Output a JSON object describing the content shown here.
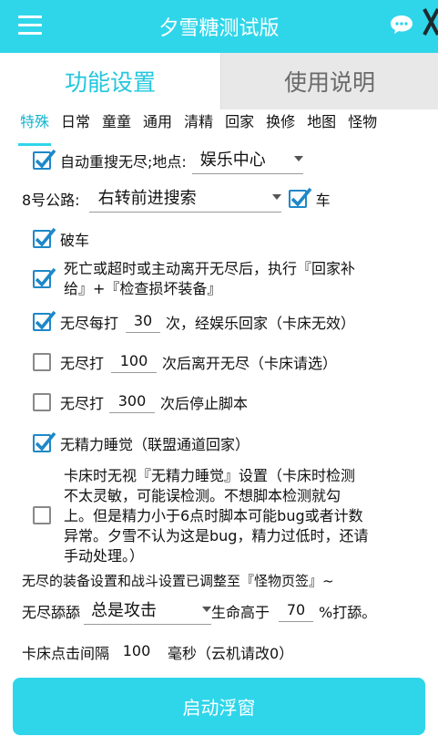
{
  "app": {
    "title": "夕雪糖测试版"
  },
  "tabs": {
    "active": "功能设置",
    "inactive": "使用说明"
  },
  "categories": [
    "特殊",
    "日常",
    "童童",
    "通用",
    "清精",
    "回家",
    "换修",
    "地图",
    "怪物"
  ],
  "settings": {
    "auto_search": {
      "checked": true,
      "label": "自动重搜无尽;地点:",
      "location": "娱乐中心"
    },
    "road8": {
      "label": "8号公路:",
      "value": "右转前进搜索",
      "car_checked": true,
      "car_label": "车"
    },
    "broken_car": {
      "checked": true,
      "label": "破车"
    },
    "death_repair": {
      "checked": true,
      "line1": "死亡或超时或主动离开无尽后，执行『回家补",
      "line2": "给』+『检查损坏装备』"
    },
    "every_hit": {
      "checked": true,
      "prefix": "无尽每打",
      "value": "30",
      "suffix": "次，经娱乐回家（卡床无效）"
    },
    "leave_after": {
      "checked": false,
      "prefix": "无尽打",
      "value": "100",
      "suffix": "次后离开无尽（卡床请选）"
    },
    "stop_after": {
      "checked": false,
      "prefix": "无尽打",
      "value": "300",
      "suffix": "次后停止脚本"
    },
    "no_energy_sleep": {
      "checked": true,
      "label": "无精力睡觉（联盟通道回家）"
    },
    "bed_ignore": {
      "checked": false,
      "lines": [
        "卡床时无视『无精力睡觉』设置（卡床时检测",
        "不太灵敏，可能误检测。不想脚本检测就勾",
        "上。但是精力小于6点时脚本可能bug或者计数",
        "异常。夕雪不认为这是bug，精力过低时，还请",
        "手动处理。）"
      ]
    },
    "notice": "无尽的装备设置和战斗设置已调整至『怪物页签』~",
    "lick": {
      "prefix": "无尽舔舔",
      "mode": "总是攻击",
      "mid": "生命高于",
      "value": "70",
      "suffix": "%打舔。"
    },
    "interval": {
      "prefix": "卡床点击间隔",
      "value": "100",
      "suffix": "毫秒（云机请改0）"
    }
  },
  "start_button": "启动浮窗",
  "colors": {
    "accent": "#2fd6ea",
    "active_tab_text": "#22c7de",
    "checkbox": "#1e88c8"
  }
}
